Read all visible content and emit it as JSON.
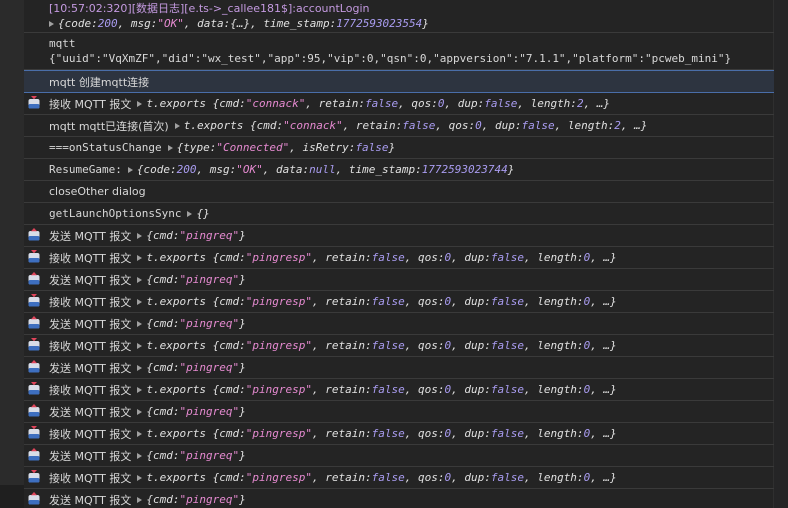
{
  "colors": {
    "background": "#242424",
    "string": "#e58ad0",
    "number_bool": "#a99cf0",
    "log_header": "#c49ae0",
    "selection": "#2d3440"
  },
  "rows": [
    {
      "type": "multi",
      "line1": "[10:57:02:320][数据日志][e.ts->_callee181$]:accountLogin",
      "line2_obj": "{code: 200, msg: \"OK\", data: {…}, time_stamp: 1772593023554}",
      "parts": {
        "code": "200",
        "msg": "\"OK\"",
        "data": "{…}",
        "ts": "1772593023554"
      }
    },
    {
      "type": "multi2",
      "line1": "mqtt",
      "line2": "{\"uuid\":\"VqXmZF\",\"did\":\"wx_test\",\"app\":95,\"vip\":0,\"qsn\":0,\"appversion\":\"7.1.1\",\"platform\":\"pcweb_mini\"}"
    },
    {
      "type": "text",
      "text": "mqtt 创建mqtt连接"
    },
    {
      "type": "recv",
      "label": "接收 MQTT 报文",
      "obj": {
        "head": "t.exports {cmd: ",
        "cmd": "\"connack\"",
        "retain": "false",
        "qos": "0",
        "dup": "false",
        "length": "2",
        "tail": ", …}"
      }
    },
    {
      "type": "text-obj",
      "text": "mqtt mqtt已连接(首次)",
      "obj": {
        "head": "t.exports {cmd: ",
        "cmd": "\"connack\"",
        "retain": "false",
        "qos": "0",
        "dup": "false",
        "length": "2",
        "tail": ", …}"
      }
    },
    {
      "type": "status",
      "text": "===onStatusChange",
      "obj": {
        "head": "{type: ",
        "typeval": "\"Connected\"",
        "mid": ", isRetry: ",
        "retry": "false",
        "tail": "}"
      }
    },
    {
      "type": "resume",
      "text": "ResumeGame:",
      "obj": {
        "code": "200",
        "msg": "\"OK\"",
        "data": "null",
        "ts": "1772593023744"
      }
    },
    {
      "type": "text",
      "text": "closeOther  dialog"
    },
    {
      "type": "text-empty",
      "text": "getLaunchOptionsSync",
      "obj": "{}"
    }
  ],
  "mqtt": {
    "send_label": "发送 MQTT 报文",
    "recv_label": "接收 MQTT 报文",
    "pingreq": "\"pingreq\"",
    "pingresp": "\"pingresp\"",
    "retain": "false",
    "qos": "0",
    "dup": "false",
    "length": "0"
  },
  "ping_sequence": [
    "send",
    "recv",
    "send",
    "recv",
    "send",
    "recv",
    "send",
    "recv",
    "send",
    "recv",
    "send",
    "recv",
    "send"
  ]
}
